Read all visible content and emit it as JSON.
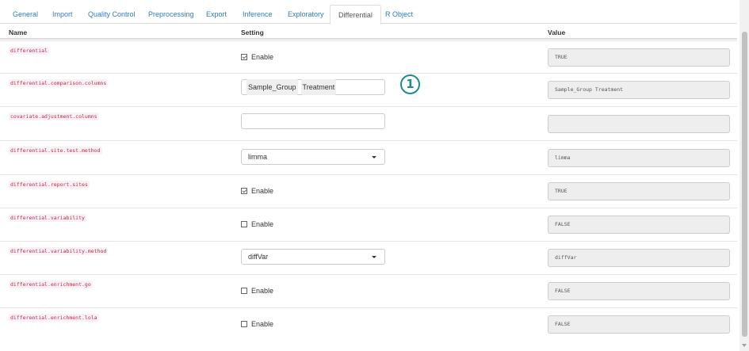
{
  "tabs": [
    "General",
    "Import",
    "Quality Control",
    "Preprocessing",
    "Export",
    "Inference",
    "Exploratory",
    "Differential",
    "R Object"
  ],
  "active_tab": "Differential",
  "headers": {
    "name": "Name",
    "setting": "Setting",
    "value": "Value"
  },
  "enable_label": "Enable",
  "badge": "1",
  "rows": [
    {
      "name": "differential",
      "kind": "checkbox",
      "checked": true,
      "value": "TRUE"
    },
    {
      "name": "differential.comparison.columns",
      "kind": "text",
      "chips": [
        "Sample_Group",
        "Treatment"
      ],
      "value": "Sample_Group Treatment"
    },
    {
      "name": "covariate.adjustment.columns",
      "kind": "text",
      "chips": [],
      "value": ""
    },
    {
      "name": "differential.site.test.method",
      "kind": "select",
      "selected": "limma",
      "value": "limma"
    },
    {
      "name": "differential.report.sites",
      "kind": "checkbox",
      "checked": true,
      "value": "TRUE"
    },
    {
      "name": "differential.variability",
      "kind": "checkbox",
      "checked": false,
      "value": "FALSE"
    },
    {
      "name": "differential.variability.method",
      "kind": "select",
      "selected": "diffVar",
      "value": "diffVar"
    },
    {
      "name": "differential.enrichment.go",
      "kind": "checkbox",
      "checked": false,
      "value": "FALSE"
    },
    {
      "name": "differential.enrichment.lola",
      "kind": "checkbox",
      "checked": false,
      "value": "FALSE"
    }
  ]
}
